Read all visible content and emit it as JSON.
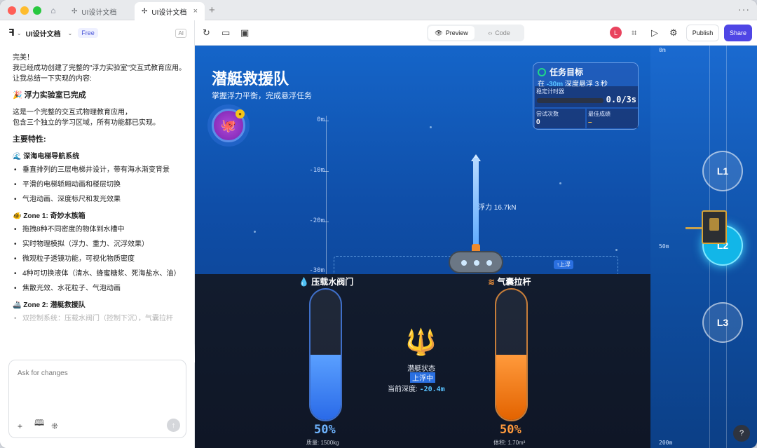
{
  "browser": {
    "tabs": [
      {
        "label": "UI设计文档"
      },
      {
        "label": "UI设计文档"
      }
    ]
  },
  "left_panel": {
    "project_name": "UI设计文档",
    "plan_badge": "Free",
    "ai_badge": "AI",
    "messages": {
      "greeting": "完美！",
      "line1": "我已经成功创建了完整的\"浮力实验室\"交互式教育应用。",
      "line2": "让我总结一下实现的内容:",
      "h_done": "🎉 浮力实验室已完成",
      "desc1": "这是一个完整的交互式物理教育应用，",
      "desc2": "包含三个独立的学习区域，所有功能都已实现。",
      "h_features": "主要特性:",
      "sec1": "🌊 深海电梯导航系统",
      "sec1_items": [
        "垂直排列的三层电梯井设计，带有海水渐变背景",
        "平滑的电梯轿厢动画和楼层切换",
        "气泡动画、深度标尺和发光效果"
      ],
      "sec2": "🐠 Zone 1: 奇妙水族箱",
      "sec2_items": [
        "拖拽8种不同密度的物体到水槽中",
        "实时物理模拟（浮力、重力、沉浮效果）",
        "微观粒子透镜功能，可视化物质密度",
        "4种可切换液体（清水、蜂蜜糖浆、死海盐水、油）",
        "焦散光效、水花粒子、气泡动画"
      ],
      "sec3": "🚢 Zone 2: 潜艇救援队",
      "sec3_partial": "双控制系统：压载水阀门（控制下沉），气囊拉杆"
    },
    "input_placeholder": "Ask for changes"
  },
  "toolbar": {
    "preview_label": "Preview",
    "code_label": "Code",
    "avatar_letter": "L",
    "publish_label": "Publish",
    "share_label": "Share"
  },
  "app": {
    "title": "潜艇救援队",
    "subtitle": "掌握浮力平衡，完成悬浮任务",
    "depth_ticks": [
      "0m",
      "-10m",
      "-20m",
      "-30m"
    ],
    "force_label": "浮力 16.7kN",
    "rising_tag": "↑上浮",
    "mission": {
      "title": "任务目标",
      "desc_prefix": "在",
      "desc_depth": "-30m",
      "desc_suffix": "深度悬浮 3 秒",
      "timer_label": "稳定计时器",
      "timer_value": "0.0/3s",
      "timer_fraction": 0.0,
      "attempts_label": "尝试次数",
      "attempts_value": "0",
      "best_label": "最佳成绩",
      "best_value": "–"
    },
    "ballast": {
      "title": "压载水阀门",
      "percent": "50%",
      "fill_fraction": 0.5,
      "meta": "质量: 1500kg"
    },
    "airbag": {
      "title": "气囊拉杆",
      "percent": "50%",
      "fill_fraction": 0.5,
      "meta": "体积: 1.70m³"
    },
    "status_label": "潜艇状态",
    "status_value": "上浮中",
    "current_depth_label": "当前深度:",
    "current_depth_value": "-20.4m",
    "elevator": {
      "depth_top": "0m",
      "depth_mid": "50m",
      "depth_bottom": "200m",
      "levels": [
        "L1",
        "L2",
        "L3"
      ],
      "active_level": "L2"
    },
    "help_label": "?"
  },
  "colors": {
    "accent": "#4f46e5",
    "ocean": "#1565c9",
    "ballast": "#2a6ae8",
    "airbag": "#ff9a3c",
    "active_level": "#12b6e8"
  }
}
